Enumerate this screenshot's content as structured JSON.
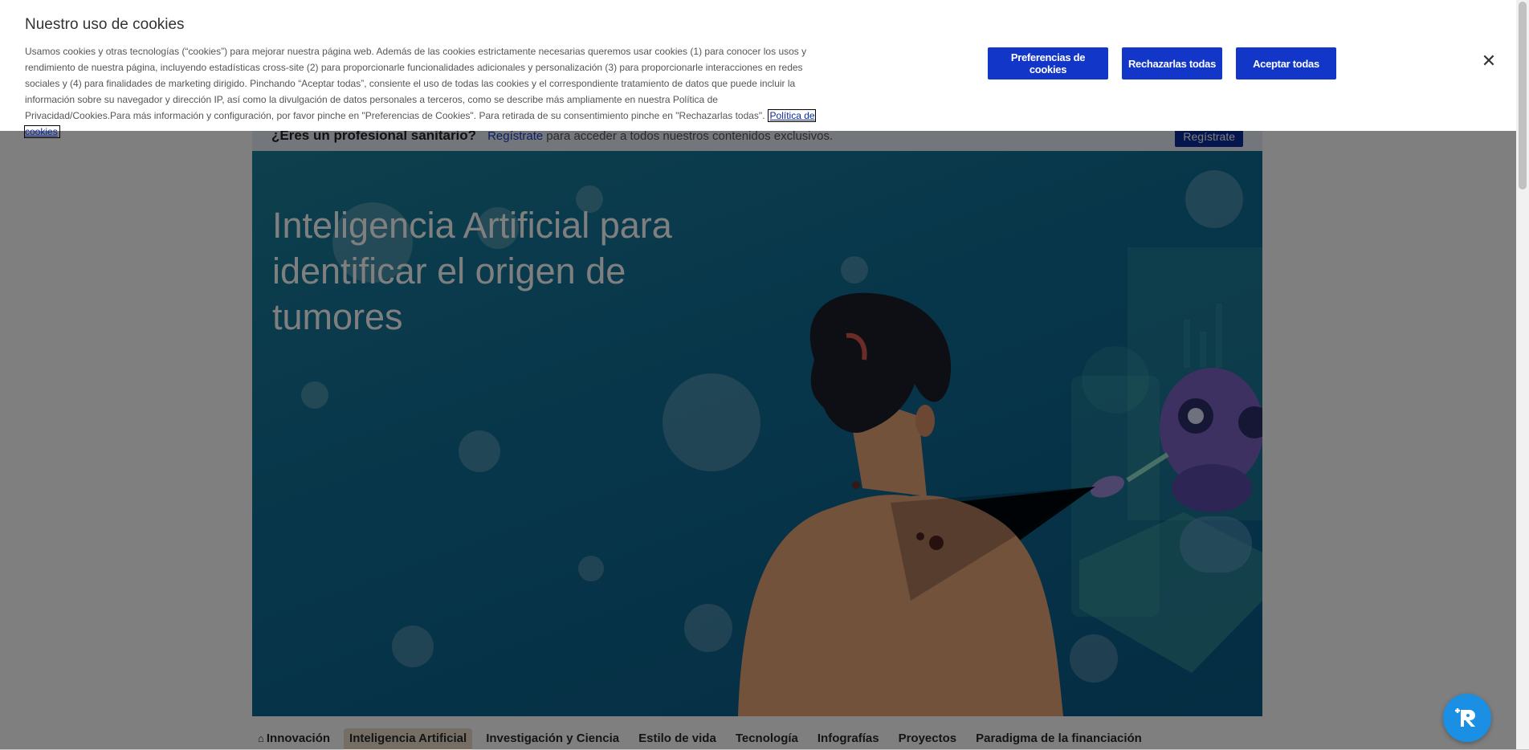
{
  "professional_bar": {
    "question": "¿Eres un profesional sanitario?",
    "link": "Regístrate",
    "rest": "para acceder a todos nuestros contenidos exclusivos.",
    "button": "Regístrate"
  },
  "hero": {
    "title": "Inteligencia Artificial para identificar el origen de tumores"
  },
  "nav": {
    "home_icon": "home-icon",
    "items": [
      "Innovación",
      "Inteligencia Artificial",
      "Investigación y Ciencia",
      "Estilo de vida",
      "Tecnología",
      "Infografías",
      "Proyectos",
      "Paradigma de la financiación"
    ],
    "active_index": 1
  },
  "cookie_banner": {
    "title": "Nuestro uso de cookies",
    "text": "Usamos cookies y otras tecnologías (“cookies”) para mejorar nuestra página web. Además de las cookies estrictamente necesarias queremos usar cookies (1) para conocer los usos y rendimiento de nuestra página, incluyendo estadísticas cross-site (2) para proporcionarle funcionalidades adicionales y personalización (3) para proporcionarle interacciones en redes sociales y (4) para finalidades de marketing dirigido. Pinchando “Aceptar todas”, consiente el uso de todas las cookies y el correspondiente tratamiento de datos que puede incluir la información sobre su navegador y dirección IP, así como la divulgación de datos personales a terceros, como se describe más ampliamente en nuestra Política de Privacidad/Cookies.Para más información y configuración, por favor pinche en \"Preferencias de Cookies\". Para retirada de su consentimiento pinche en \"Rechazarlas todas\".",
    "policy_link": "Política de cookies",
    "buttons": {
      "preferences": "Preferencias de cookies",
      "reject": "Rechazarlas todas",
      "accept": "Aceptar todas"
    },
    "close_icon": "close-icon"
  },
  "colors": {
    "accent": "#1237c8",
    "hero_bg": "#0f6d95",
    "overlay": "rgba(0,0,0,0.5)",
    "fab": "#1a8fe3"
  }
}
